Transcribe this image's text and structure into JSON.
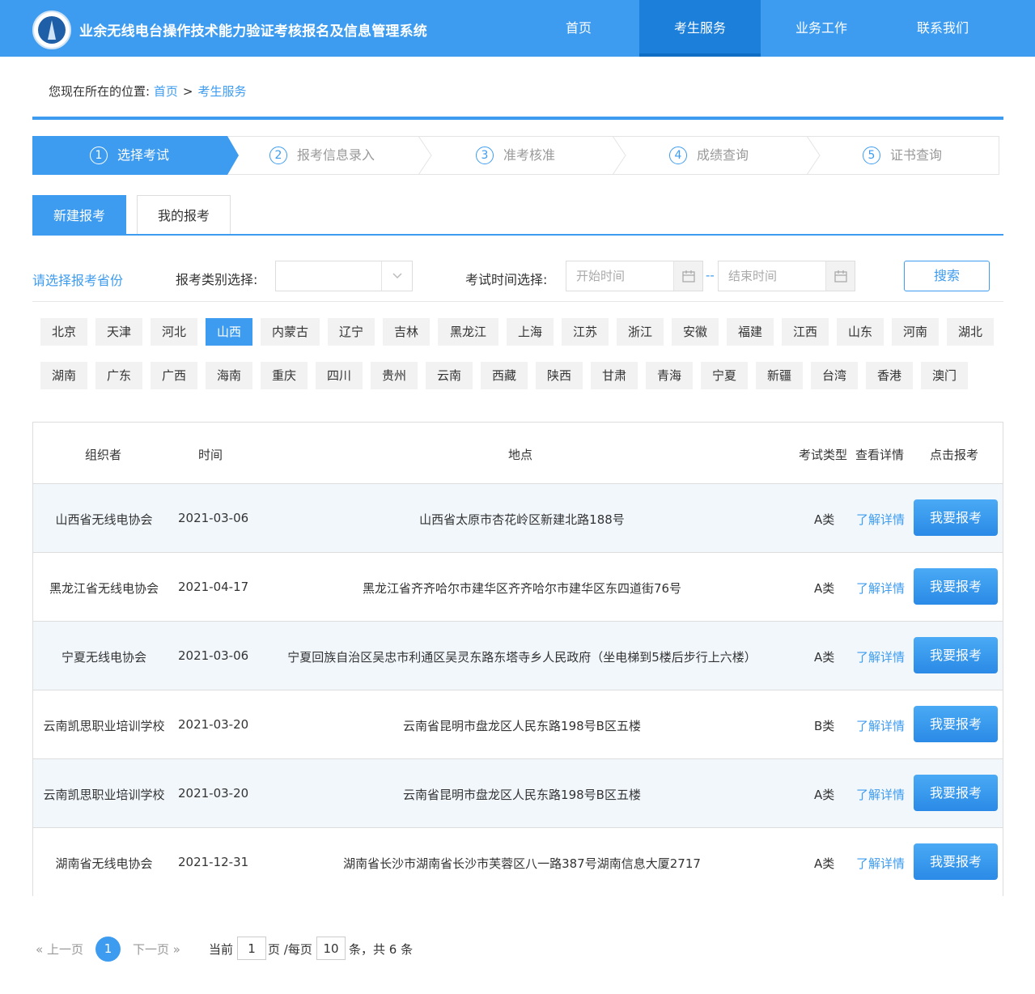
{
  "header": {
    "title": "业余无线电台操作技术能力验证考核报名及信息管理系统",
    "nav": [
      "首页",
      "考生服务",
      "业务工作",
      "联系我们"
    ],
    "brand_color": "#3d9cf0"
  },
  "breadcrumb": {
    "prefix": "您现在所在的位置:",
    "home": "首页",
    "sep": ">",
    "current": "考生服务"
  },
  "steps": [
    {
      "num": "1",
      "label": "选择考试"
    },
    {
      "num": "2",
      "label": "报考信息录入"
    },
    {
      "num": "3",
      "label": "准考核准"
    },
    {
      "num": "4",
      "label": "成绩查询"
    },
    {
      "num": "5",
      "label": "证书查询"
    }
  ],
  "tabs": [
    "新建报考",
    "我的报考"
  ],
  "filters": {
    "province_label": "请选择报考省份",
    "category_label": "报考类别选择:",
    "category_value": "",
    "time_label": "考试时间选择:",
    "start_placeholder": "开始时间",
    "range_sep": "--",
    "end_placeholder": "结束时间",
    "search": "搜索"
  },
  "provinces": [
    "北京",
    "天津",
    "河北",
    "山西",
    "内蒙古",
    "辽宁",
    "吉林",
    "黑龙江",
    "上海",
    "江苏",
    "浙江",
    "安徽",
    "福建",
    "江西",
    "山东",
    "河南",
    "湖北",
    "湖南",
    "广东",
    "广西",
    "海南",
    "重庆",
    "四川",
    "贵州",
    "云南",
    "西藏",
    "陕西",
    "甘肃",
    "青海",
    "宁夏",
    "新疆",
    "台湾",
    "香港",
    "澳门"
  ],
  "selected_province": "山西",
  "table": {
    "headers": [
      "组织者",
      "时间",
      "地点",
      "考试类型",
      "查看详情",
      "点击报考"
    ],
    "detail_text": "了解详情",
    "apply_text": "我要报考",
    "rows": [
      [
        "山西省无线电协会",
        "2021-03-06",
        "山西省太原市杏花岭区新建北路188号",
        "A类"
      ],
      [
        "黑龙江省无线电协会",
        "2021-04-17",
        "黑龙江省齐齐哈尔市建华区齐齐哈尔市建华区东四道街76号",
        "A类"
      ],
      [
        "宁夏无线电协会",
        "2021-03-06",
        "宁夏回族自治区吴忠市利通区吴灵东路东塔寺乡人民政府（坐电梯到5楼后步行上六楼）",
        "A类"
      ],
      [
        "云南凯思职业培训学校",
        "2021-03-20",
        "云南省昆明市盘龙区人民东路198号B区五楼",
        "B类"
      ],
      [
        "云南凯思职业培训学校",
        "2021-03-20",
        "云南省昆明市盘龙区人民东路198号B区五楼",
        "A类"
      ],
      [
        "湖南省无线电协会",
        "2021-12-31",
        "湖南省长沙市湖南省长沙市芙蓉区八一路387号湖南信息大厦2717",
        "A类"
      ]
    ]
  },
  "pager": {
    "prev": "« 上一页",
    "page": "1",
    "next": "下一页 »",
    "current_label": "当前",
    "current_value": "1",
    "per_page_label": "页 /每页",
    "per_page_value": "10",
    "total_text": "条，共 6 条"
  }
}
